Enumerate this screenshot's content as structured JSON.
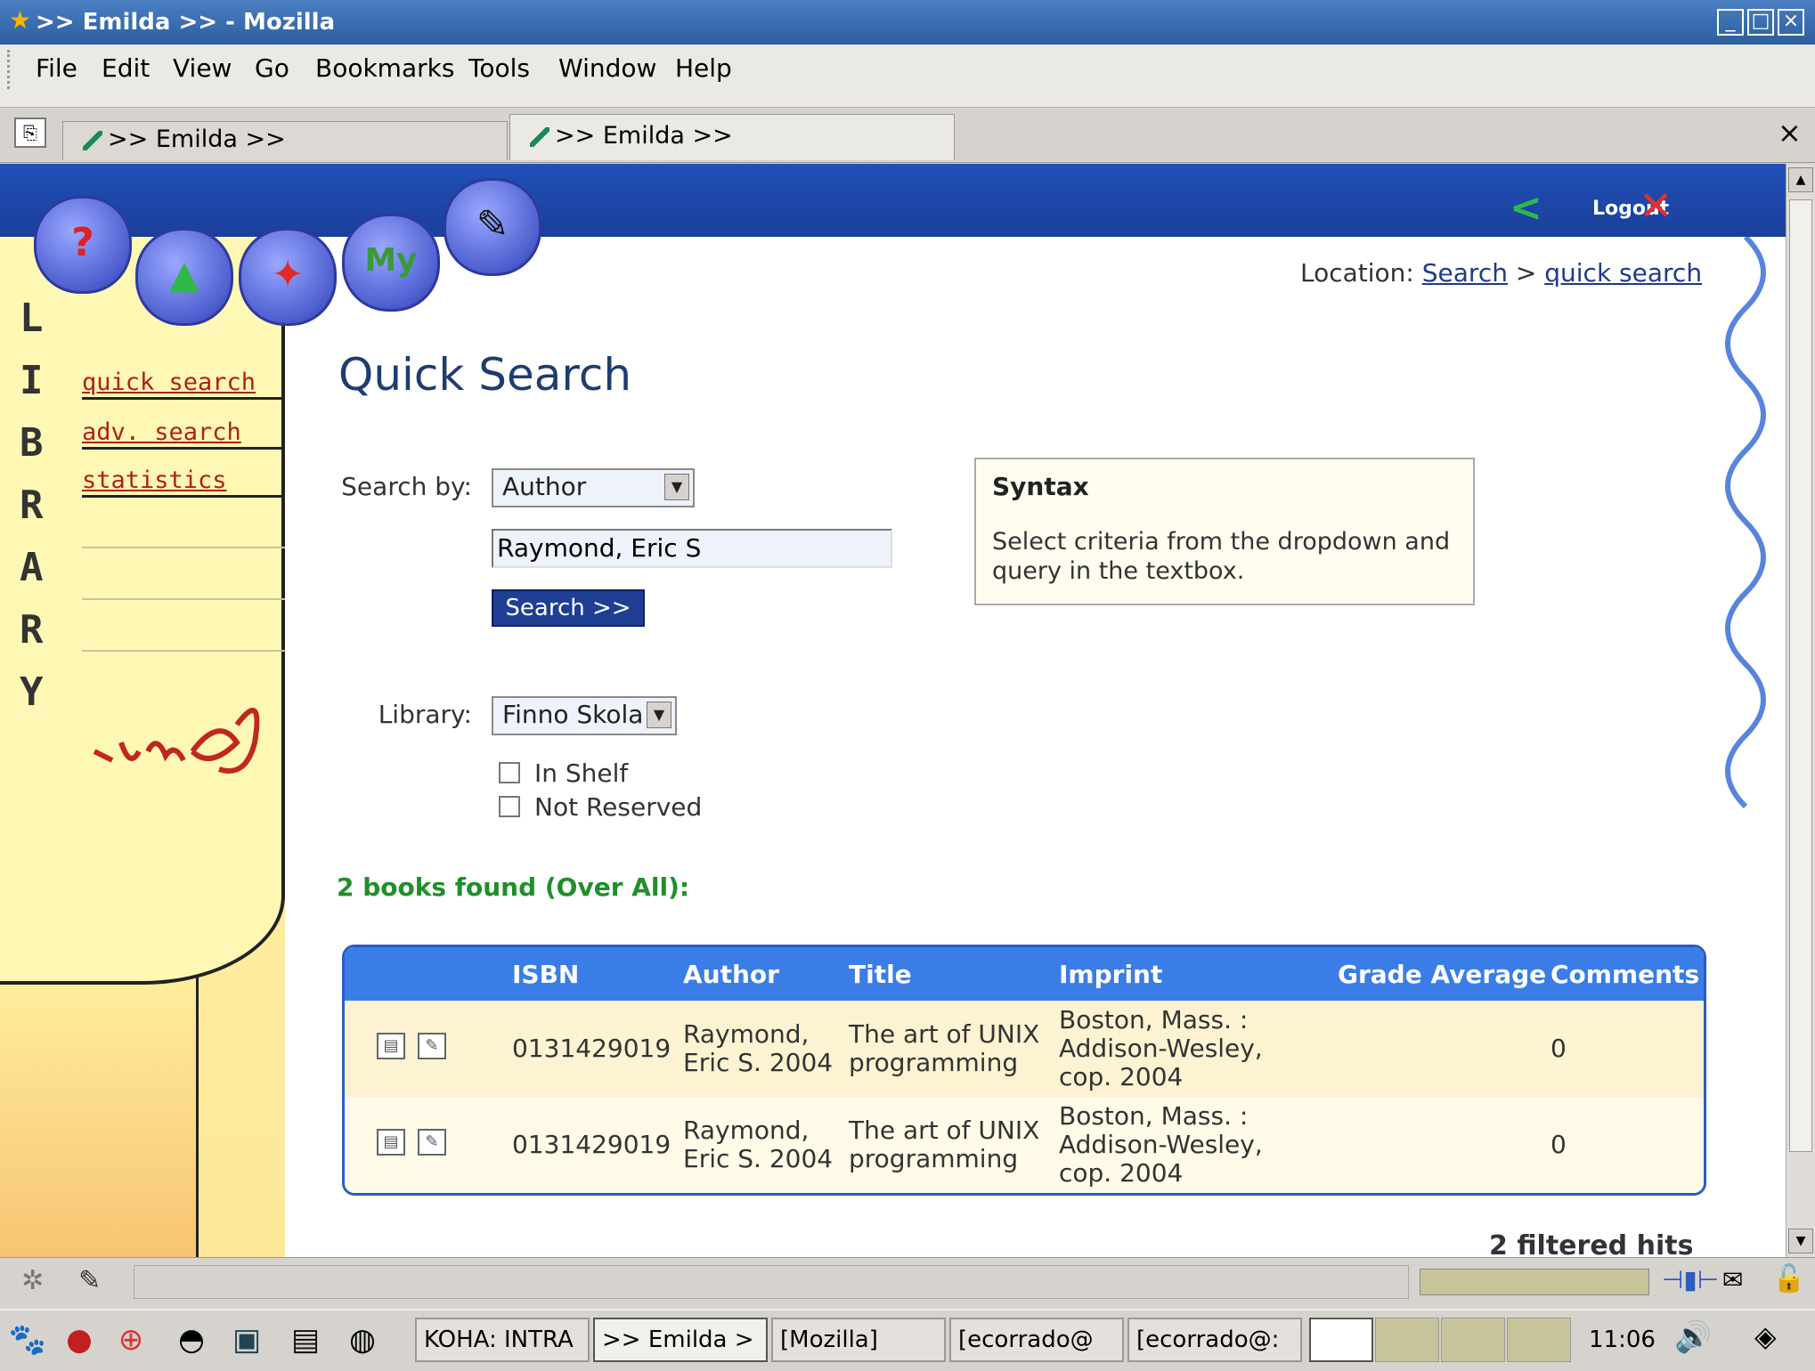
{
  "window": {
    "title": ">> Emilda >> - Mozilla",
    "controls": [
      "minimize-icon",
      "maximize-icon",
      "close-icon"
    ]
  },
  "menubar": {
    "items": [
      "File",
      "Edit",
      "View",
      "Go",
      "Bookmarks",
      "Tools",
      "Window",
      "Help"
    ]
  },
  "tabs": {
    "items": [
      {
        "label": ">> Emilda >>",
        "active": false
      },
      {
        "label": ">> Emilda >>",
        "active": true
      }
    ],
    "close": "×"
  },
  "header": {
    "logout": "Logout",
    "location_label": "Location:",
    "breadcrumb": [
      "Search",
      "quick search"
    ],
    "breadcrumb_sep": ">"
  },
  "sidebar": {
    "nav_icons": [
      "help-icon",
      "add-book-icon",
      "stats-icon",
      "my-books-icon",
      "write-icon"
    ],
    "my_label": "My",
    "letters": [
      "L",
      "I",
      "B",
      "R",
      "A",
      "R",
      "Y"
    ],
    "links": [
      "quick search",
      "adv. search",
      "statistics"
    ]
  },
  "page": {
    "title": "Quick Search",
    "search_by_label": "Search by:",
    "search_by_value": "Author",
    "query_value": "Raymond, Eric S",
    "search_button": "Search >>",
    "library_label": "Library:",
    "library_value": "Finno Skola",
    "checkboxes": [
      {
        "label": "In Shelf",
        "checked": false
      },
      {
        "label": "Not Reserved",
        "checked": false
      }
    ],
    "syntax": {
      "heading": "Syntax",
      "body": "Select criteria from the dropdown and query in the textbox."
    },
    "found_text": "2 books found (Over All):",
    "filtered_text": "2 filtered hits"
  },
  "results": {
    "columns": [
      "ISBN",
      "Author",
      "Title",
      "Imprint",
      "Grade Average",
      "Comments"
    ],
    "rows": [
      {
        "isbn": "0131429019",
        "author": [
          "Raymond,",
          "Eric S. 2004"
        ],
        "title": [
          "The art of UNIX",
          "programming"
        ],
        "imprint": [
          "Boston, Mass. :",
          "Addison-Wesley,",
          "cop. 2004"
        ],
        "grade": "",
        "comments": "0"
      },
      {
        "isbn": "0131429019",
        "author": [
          "Raymond,",
          "Eric S. 2004"
        ],
        "title": [
          "The art of UNIX",
          "programming"
        ],
        "imprint": [
          "Boston, Mass. :",
          "Addison-Wesley,",
          "cop. 2004"
        ],
        "grade": "",
        "comments": "0"
      }
    ],
    "row_colors": [
      "#fdf3d2",
      "#fffbe8"
    ]
  },
  "taskbar": {
    "tasks": [
      "KOHA: INTRA",
      ">> Emilda >",
      "[Mozilla]",
      "[ecorrado@",
      "[ecorrado@:"
    ],
    "clock": "11:06"
  }
}
